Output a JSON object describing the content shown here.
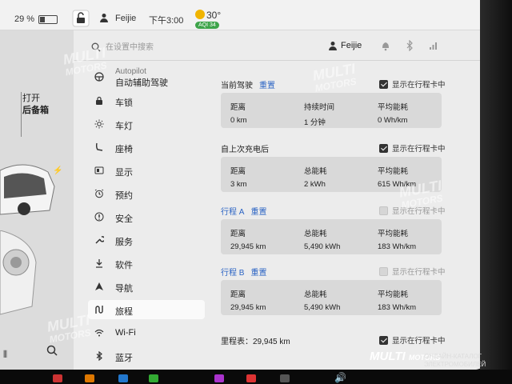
{
  "status_bar": {
    "battery": "29 %",
    "user": "Feijie",
    "time": "下午3:00",
    "temperature": "30°",
    "aqi": "AQI 34"
  },
  "car_panel": {
    "trunk_line1": "打开",
    "trunk_line2": "后备箱"
  },
  "settings_top": {
    "search_placeholder": "在设置中搜索",
    "user": "Feijie"
  },
  "sidebar": {
    "autopilot_en": "Autopilot",
    "autopilot_cn": "自动辅助驾驶",
    "items": [
      {
        "label": "车锁",
        "icon": "lock-icon"
      },
      {
        "label": "车灯",
        "icon": "light-icon"
      },
      {
        "label": "座椅",
        "icon": "seat-icon"
      },
      {
        "label": "显示",
        "icon": "display-icon"
      },
      {
        "label": "预约",
        "icon": "alarm-icon"
      },
      {
        "label": "安全",
        "icon": "safety-icon"
      },
      {
        "label": "服务",
        "icon": "wrench-icon"
      },
      {
        "label": "软件",
        "icon": "download-icon"
      },
      {
        "label": "导航",
        "icon": "navigation-icon"
      },
      {
        "label": "旅程",
        "icon": "trip-icon",
        "active": true
      },
      {
        "label": "Wi-Fi",
        "icon": "wifi-icon"
      },
      {
        "label": "蓝牙",
        "icon": "bluetooth-icon"
      }
    ]
  },
  "trips": {
    "current": {
      "title": "当前驾驶",
      "reset": "重置",
      "show_label": "显示在行程卡中",
      "checked": true,
      "stats": [
        {
          "key": "距离",
          "value": "0 km"
        },
        {
          "key": "持续时间",
          "value": "1 分钟"
        },
        {
          "key": "平均能耗",
          "value": "0 Wh/km"
        }
      ]
    },
    "since_charge": {
      "title": "自上次充电后",
      "show_label": "显示在行程卡中",
      "checked": true,
      "stats": [
        {
          "key": "距离",
          "value": "3 km"
        },
        {
          "key": "总能耗",
          "value": "2 kWh"
        },
        {
          "key": "平均能耗",
          "value": "615 Wh/km"
        }
      ]
    },
    "trip_a": {
      "title": "行程 A",
      "reset": "重置",
      "show_label": "显示在行程卡中",
      "checked": false,
      "stats": [
        {
          "key": "距离",
          "value": "29,945 km"
        },
        {
          "key": "总能耗",
          "value": "5,490 kWh"
        },
        {
          "key": "平均能耗",
          "value": "183 Wh/km"
        }
      ]
    },
    "trip_b": {
      "title": "行程 B",
      "reset": "重置",
      "show_label": "显示在行程卡中",
      "checked": false,
      "stats": [
        {
          "key": "距离",
          "value": "29,945 km"
        },
        {
          "key": "总能耗",
          "value": "5,490 kWh"
        },
        {
          "key": "平均能耗",
          "value": "183 Wh/km"
        }
      ]
    },
    "odometer": {
      "label": "里程表：29,945 km",
      "show_label": "显示在行程卡中",
      "checked": true
    }
  },
  "watermark": {
    "brand_top": "MULTI",
    "brand_bottom": "MOTORS",
    "footer_brand": "MULTI",
    "footer_brand2": "MOTORS",
    "footer_tag1": "ОНЛАЙН-КАТАЛОГ",
    "footer_tag2": "ЭЛЕКТРОМОБИЛЕЙ"
  },
  "colors": {
    "accent_link": "#2a63c4",
    "aqi_green": "#3ea44a",
    "active_item_bg": "#fafafa",
    "stat_box_bg": "#d9d9d9"
  }
}
